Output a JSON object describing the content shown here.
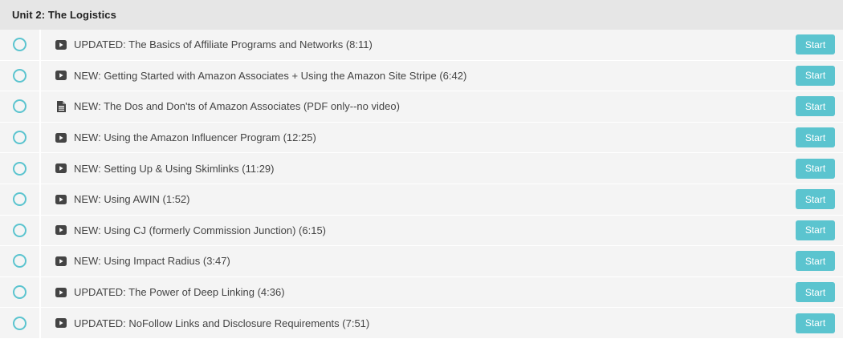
{
  "section": {
    "title": "Unit 2: The Logistics"
  },
  "colors": {
    "accent": "#5bc4cf",
    "row_background": "#f4f4f4",
    "header_background": "#e6e6e6",
    "icon": "#444444"
  },
  "lectures": [
    {
      "title": "UPDATED: The Basics of Affiliate Programs and Networks (8:11)",
      "icon": "video-play-icon",
      "button_label": "Start"
    },
    {
      "title": "NEW: Getting Started with Amazon Associates + Using the Amazon Site Stripe (6:42)",
      "icon": "video-play-icon",
      "button_label": "Start"
    },
    {
      "title": "NEW: The Dos and Don'ts of Amazon Associates (PDF only--no video)",
      "icon": "document-icon",
      "button_label": "Start"
    },
    {
      "title": "NEW: Using the Amazon Influencer Program (12:25)",
      "icon": "video-play-icon",
      "button_label": "Start"
    },
    {
      "title": "NEW: Setting Up & Using Skimlinks (11:29)",
      "icon": "video-play-icon",
      "button_label": "Start"
    },
    {
      "title": "NEW: Using AWIN (1:52)",
      "icon": "video-play-icon",
      "button_label": "Start"
    },
    {
      "title": "NEW: Using CJ (formerly Commission Junction) (6:15)",
      "icon": "video-play-icon",
      "button_label": "Start"
    },
    {
      "title": "NEW: Using Impact Radius (3:47)",
      "icon": "video-play-icon",
      "button_label": "Start"
    },
    {
      "title": "UPDATED: The Power of Deep Linking (4:36)",
      "icon": "video-play-icon",
      "button_label": "Start"
    },
    {
      "title": "UPDATED: NoFollow Links and Disclosure Requirements (7:51)",
      "icon": "video-play-icon",
      "button_label": "Start"
    }
  ]
}
